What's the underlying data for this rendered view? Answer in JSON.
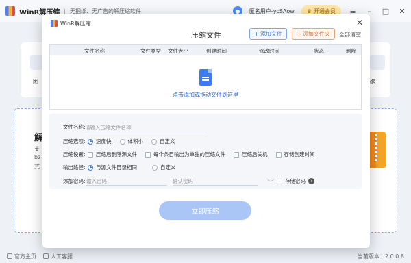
{
  "app": {
    "name": "WinR解压缩",
    "separator": "|",
    "slogan": "无捆绑、无广告的解压缩软件",
    "user_name": "匿名用户-ycSAow",
    "vip_label": "开通会员",
    "background": {
      "tile_left_label": "图",
      "tile_right_label": "缩",
      "big_title": "解",
      "lines": [
        "支",
        "bz",
        "式"
      ]
    },
    "footer": {
      "home": "官方主页",
      "support": "人工客服",
      "version": "当前版本：2.0.0.8"
    }
  },
  "dialog": {
    "title": "WinR解压缩",
    "heading": "压缩文件",
    "add_file": "添加文件",
    "add_folder": "添加文件夹",
    "clear_all": "全部清空",
    "columns": [
      "文件名称",
      "文件类型",
      "文件大小",
      "创建时间",
      "修改时间",
      "状态",
      "删除"
    ],
    "drop_hint": "点击添加或拖动文件到这里",
    "file_name": {
      "label": "文件名称:",
      "placeholder": "请输入压缩文件名称"
    },
    "compress_options": {
      "label": "压缩选项:",
      "choices": [
        "速度快",
        "体积小",
        "自定义"
      ],
      "selected": "速度快"
    },
    "compress_settings": {
      "label": "压缩设置:",
      "items": [
        "压缩后删除源文件",
        "每个条目输出为单独的压缩文件",
        "压缩后关机",
        "存储创建时间"
      ]
    },
    "output_path": {
      "label": "输出路径:",
      "choices": [
        "与源文件目录相同",
        "自定义"
      ],
      "selected": "与源文件目录相同"
    },
    "password": {
      "label": "添加密码:",
      "placeholder": "输入密码",
      "confirm_placeholder": "确认密码",
      "store_label": "存储密码"
    },
    "compress_button": "立即压缩"
  }
}
